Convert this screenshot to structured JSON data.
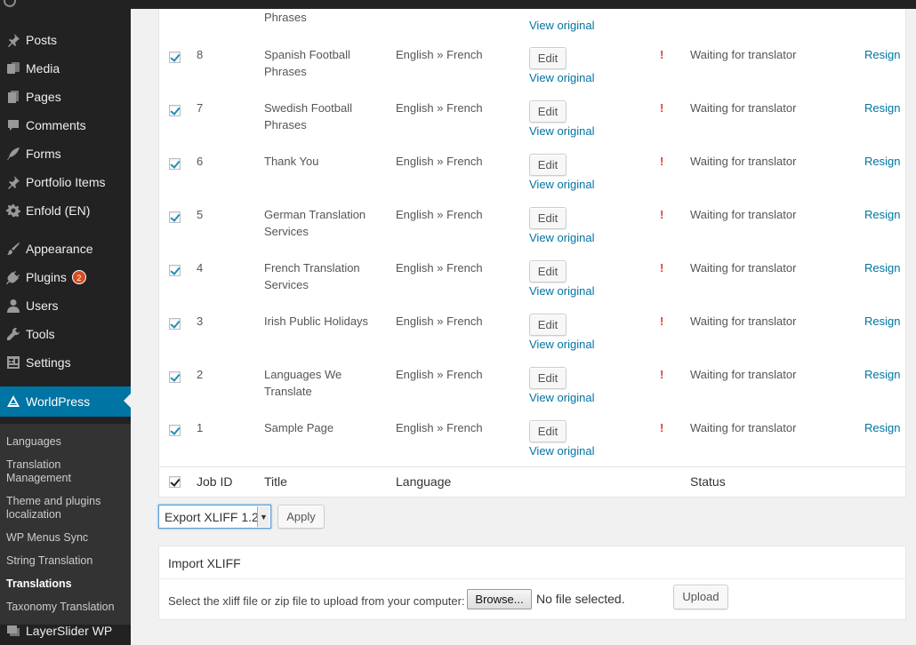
{
  "sidebar": {
    "items": [
      {
        "label": "Posts",
        "icon": "pin-icon"
      },
      {
        "label": "Media",
        "icon": "media-icon"
      },
      {
        "label": "Pages",
        "icon": "pages-icon"
      },
      {
        "label": "Comments",
        "icon": "comment-icon"
      },
      {
        "label": "Forms",
        "icon": "feather-icon"
      },
      {
        "label": "Portfolio Items",
        "icon": "pin-icon"
      },
      {
        "label": "Enfold (EN)",
        "icon": "gear-icon"
      },
      {
        "label": "Appearance",
        "icon": "brush-icon"
      },
      {
        "label": "Plugins",
        "icon": "plug-icon",
        "badge": "2"
      },
      {
        "label": "Users",
        "icon": "user-icon"
      },
      {
        "label": "Tools",
        "icon": "wrench-icon"
      },
      {
        "label": "Settings",
        "icon": "settings-icon"
      }
    ],
    "current": {
      "label": "WorldPress",
      "icon": "worldpress-icon"
    },
    "submenu": [
      "Languages",
      "Translation Management",
      "Theme and plugins localization",
      "WP Menus Sync",
      "String Translation",
      "Translations",
      "Taxonomy Translation"
    ],
    "active_submenu": "Translations",
    "bottom": {
      "label": "LayerSlider WP",
      "icon": "layers-icon"
    }
  },
  "table": {
    "partial_top_title": "Phrases",
    "partial_top_view": "View original",
    "edit_label": "Edit",
    "view_label": "View original",
    "warning": "!",
    "resign_label": "Resign",
    "rows": [
      {
        "id": "8",
        "title": "Spanish Football Phrases",
        "language": "English » French",
        "status": "Waiting for translator",
        "checked": true
      },
      {
        "id": "7",
        "title": "Swedish Football Phrases",
        "language": "English » French",
        "status": "Waiting for translator",
        "checked": true
      },
      {
        "id": "6",
        "title": "Thank You",
        "language": "English » French",
        "status": "Waiting for translator",
        "checked": true
      },
      {
        "id": "5",
        "title": "German Translation Services",
        "language": "English » French",
        "status": "Waiting for translator",
        "checked": true
      },
      {
        "id": "4",
        "title": "French Translation Services",
        "language": "English » French",
        "status": "Waiting for translator",
        "checked": true
      },
      {
        "id": "3",
        "title": "Irish Public Holidays",
        "language": "English » French",
        "status": "Waiting for translator",
        "checked": true
      },
      {
        "id": "2",
        "title": "Languages We Translate",
        "language": "English » French",
        "status": "Waiting for translator",
        "checked": true
      },
      {
        "id": "1",
        "title": "Sample Page",
        "language": "English » French",
        "status": "Waiting for translator",
        "checked": true
      }
    ],
    "footer": {
      "job_id": "Job ID",
      "title": "Title",
      "language": "Language",
      "status": "Status"
    }
  },
  "bulk": {
    "selected": "Export XLIFF 1.2",
    "apply_label": "Apply"
  },
  "import": {
    "heading": "Import XLIFF",
    "instructions": "Select the xliff file or zip file to upload from your computer:",
    "browse_label": "Browse...",
    "no_file": "No file selected.",
    "upload_label": "Upload"
  }
}
